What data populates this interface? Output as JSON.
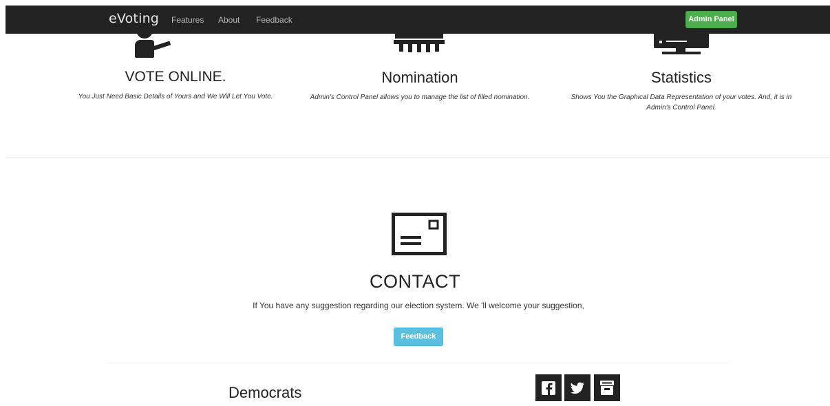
{
  "navbar": {
    "brand": "eVoting",
    "links": [
      "Features",
      "About",
      "Feedback"
    ],
    "admin_button": "Admin Panel"
  },
  "features": [
    {
      "title": "VOTE ONLINE.",
      "description": "You Just Need Basic Details of Yours and We Will Let You Vote.",
      "icon": "voter-icon"
    },
    {
      "title": "Nomination",
      "description": "Admin's Control Panel allows you to manage the list of filled nomination.",
      "icon": "ballot-box-icon"
    },
    {
      "title": "Statistics",
      "description_line1": "Shows You the Graphical Data Representation of your votes. And, it is in",
      "description_line2": "Admin's Control Panel.",
      "icon": "monitor-icon"
    }
  ],
  "contact": {
    "icon": "envelope-icon",
    "title": "CONTACT",
    "text": "If You have any suggestion regarding our election system. We 'll welcome your suggestion,",
    "button": "Feedback"
  },
  "footer": {
    "name": "Democrats",
    "social": [
      "facebook-icon",
      "twitter-icon",
      "archive-icon"
    ]
  },
  "colors": {
    "navbar_bg": "#222222",
    "admin_button": "#4cae4c",
    "feedback_button": "#5bc0de"
  }
}
